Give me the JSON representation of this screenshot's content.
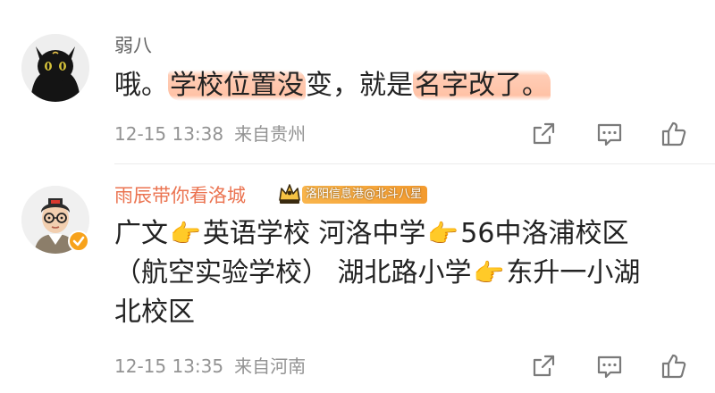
{
  "comments": [
    {
      "username": "弱八",
      "content": {
        "prefix": "哦。",
        "highlight_1": "学校位置没",
        "middle": "变，就是",
        "highlight_2": "名字改了。"
      },
      "timestamp": "12-15 13:38",
      "location": "来自贵州",
      "avatar": "black-cat-avatar",
      "actions": [
        "share-icon",
        "reply-icon",
        "like-icon"
      ]
    },
    {
      "username": "雨辰带你看洛城",
      "badge_text": "洛阳信息港@北斗八星",
      "verified": true,
      "content": {
        "line_1": [
          "广文",
          "英语学校 河洛中学",
          "56中洛浦校区"
        ],
        "line_2": [
          "（航空实验学校） 湖北路小学",
          "东升一小湖"
        ],
        "line_3": "北校区",
        "pointer_emoji": "👉"
      },
      "timestamp": "12-15 13:35",
      "location": "来自河南",
      "avatar": "cartoon-man-avatar",
      "actions": [
        "share-icon",
        "reply-icon",
        "like-icon"
      ]
    }
  ],
  "colors": {
    "username_default": "#636363",
    "username_vip": "#eb7350",
    "highlight": "#ffc2a6",
    "meta_text": "#939393",
    "badge": "#f39a2e",
    "verified": "#f7a21b",
    "icon_stroke": "#7a7a7a"
  }
}
